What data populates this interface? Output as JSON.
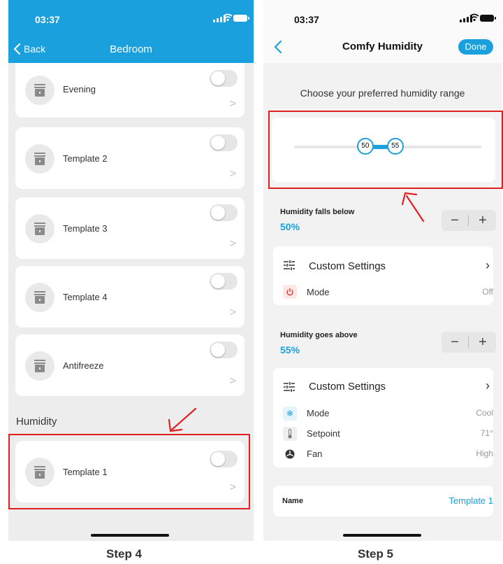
{
  "left_screen": {
    "status": {
      "time": "03:37"
    },
    "nav": {
      "back_label": "Back",
      "title": "Bedroom"
    },
    "items": [
      {
        "label": "Evening",
        "enabled": false
      },
      {
        "label": "Template 2",
        "enabled": false
      },
      {
        "label": "Template 3",
        "enabled": false
      },
      {
        "label": "Template 4",
        "enabled": false
      },
      {
        "label": "Antifreeze",
        "enabled": false
      }
    ],
    "section_title": "Humidity",
    "humidity_item": {
      "label": "Template 1",
      "enabled": false
    }
  },
  "right_screen": {
    "status": {
      "time": "03:37"
    },
    "nav": {
      "title": "Comfy Humidity",
      "done_label": "Done"
    },
    "prompt": "Choose your preferred humidity range",
    "range": {
      "low": "50",
      "high": "55",
      "min_fraction": 0.38,
      "max_fraction": 0.54
    },
    "falls_below": {
      "label": "Humidity falls below",
      "value": "50%",
      "custom_label": "Custom Settings",
      "chevron": "›",
      "rows": [
        {
          "label": "Mode",
          "value": "Off",
          "icon": "power-icon"
        }
      ]
    },
    "goes_above": {
      "label": "Humidity goes above",
      "value": "55%",
      "custom_label": "Custom Settings",
      "chevron": "›",
      "rows": [
        {
          "label": "Mode",
          "value": "Cool",
          "icon": "snowflake-icon"
        },
        {
          "label": "Setpoint",
          "value": "71°",
          "icon": "thermometer-icon"
        },
        {
          "label": "Fan",
          "value": "High",
          "icon": "fan-icon"
        }
      ]
    },
    "name": {
      "label": "Name",
      "value": "Template 1"
    }
  },
  "captions": {
    "left": "Step 4",
    "right": "Step 5"
  },
  "colors": {
    "accent": "#1aa0dc",
    "annotation": "#e02020",
    "power": "#d9463b"
  }
}
